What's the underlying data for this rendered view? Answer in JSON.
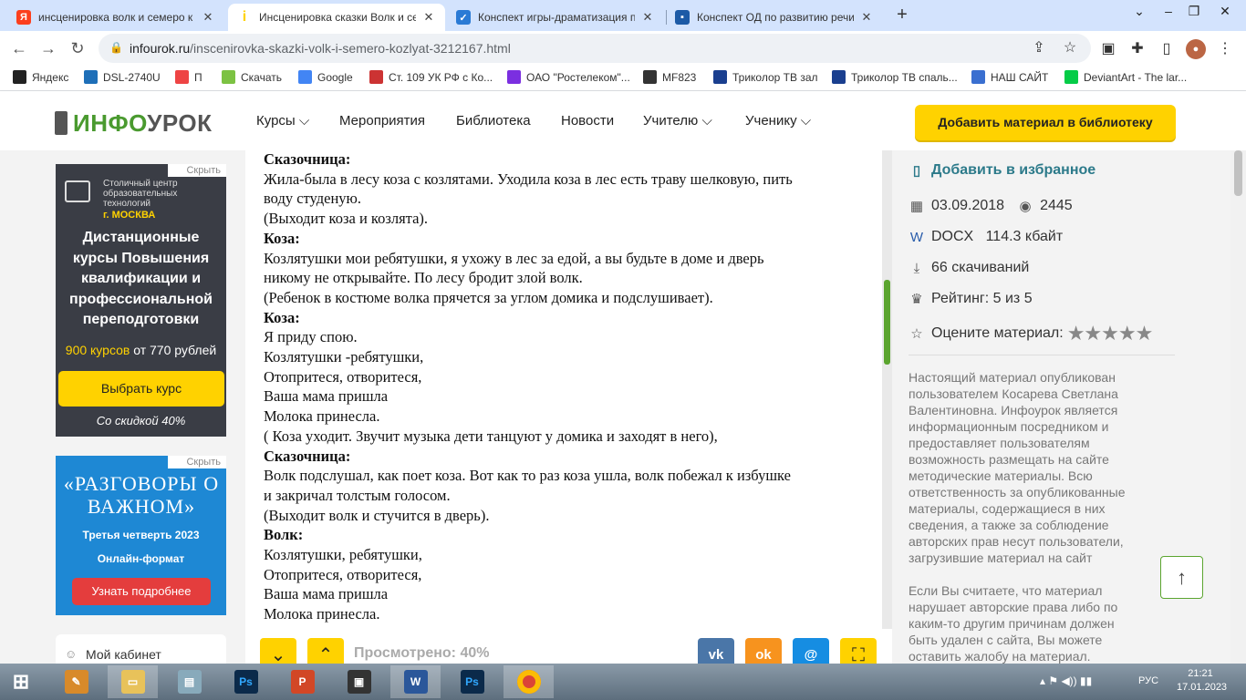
{
  "browser": {
    "tabs": [
      {
        "title": "инсценировка волк и семеро к",
        "favicon": "Я",
        "color": "#fc3f1d",
        "active": false
      },
      {
        "title": "Инсценировка сказки Волк и се",
        "favicon": "i",
        "color": "#ffd200",
        "active": true
      },
      {
        "title": "Конспект игры-драматизация п",
        "favicon": "✓",
        "color": "#2a7ad5",
        "active": false
      },
      {
        "title": "Конспект ОД по развитию речи",
        "favicon": "▪",
        "color": "#1c5aa6",
        "active": false
      }
    ],
    "new_tab": "+",
    "url_domain": "infourok.ru",
    "url_path": "/inscenirovka-skazki-volk-i-semero-kozlyat-3212167.html"
  },
  "bookmarks": [
    {
      "label": "Яндекс",
      "color": "#222"
    },
    {
      "label": "DSL-2740U",
      "color": "#1e6fb8"
    },
    {
      "label": "П",
      "color": "#e44"
    },
    {
      "label": "Скачать",
      "color": "#7cc243"
    },
    {
      "label": "Google",
      "color": "#4285f4"
    },
    {
      "label": "Ст. 109 УК РФ с Ко...",
      "color": "#c33"
    },
    {
      "label": "ОАО \"Ростелеком\"...",
      "color": "#7b2fe0"
    },
    {
      "label": "MF823",
      "color": "#333"
    },
    {
      "label": "Триколор ТВ зал",
      "color": "#1a3f8f"
    },
    {
      "label": "Триколор ТВ спаль...",
      "color": "#1a3f8f"
    },
    {
      "label": "НАШ САЙТ",
      "color": "#3a6fd0"
    },
    {
      "label": "DeviantArt - The lar...",
      "color": "#05cc47"
    }
  ],
  "site": {
    "logo_green": "ИНФО",
    "logo_gray": "УРОК",
    "nav": [
      "Курсы",
      "Мероприятия",
      "Библиотека",
      "Новости",
      "Учителю",
      "Ученику"
    ],
    "add_button": "Добавить материал в библиотеку"
  },
  "ad1": {
    "hide": "Скрыть",
    "org": "Столичный центр образовательных технологий",
    "city": "г. МОСКВА",
    "headline": "Дистанционные курсы Повышения квалификации и профессиональной переподготовки",
    "count": "900 курсов",
    "price": "от 770 рублей",
    "button": "Выбрать курс",
    "discount": "Со скидкой 40%"
  },
  "ad2": {
    "hide": "Скрыть",
    "title": "«РАЗГОВОРЫ О ВАЖНОМ»",
    "quarter": "Третья четверть 2023",
    "format": "Онлайн-формат",
    "button": "Узнать подробнее"
  },
  "cabinet": "Мой кабинет",
  "document": {
    "lines": [
      {
        "t": "Сказочница:",
        "b": true
      },
      {
        "t": "Жила-была в лесу коза с козлятами. Уходила коза в лес есть траву шелковую, пить",
        "b": false
      },
      {
        "t": "воду студеную.",
        "b": false
      },
      {
        "t": "(Выходит коза и козлята).",
        "b": false
      },
      {
        "t": "Коза:",
        "b": true
      },
      {
        "t": "Козлятушки мои ребятушки, я ухожу в лес за едой, а вы будьте в доме и дверь",
        "b": false
      },
      {
        "t": "никому не открывайте. По лесу бродит злой волк.",
        "b": false
      },
      {
        "t": "(Ребенок в костюме волка прячется за углом домика и подслушивает).",
        "b": false
      },
      {
        "t": "Коза:",
        "b": true
      },
      {
        "t": "Я приду спою.",
        "b": false
      },
      {
        "t": "Козлятушки -ребятушки,",
        "b": false
      },
      {
        "t": "Отопритеся, отворитеся,",
        "b": false
      },
      {
        "t": "Ваша мама пришла",
        "b": false
      },
      {
        "t": "Молока принесла.",
        "b": false
      },
      {
        "t": "( Коза уходит. Звучит музыка дети танцуют у домика и заходят в него),",
        "b": false
      },
      {
        "t": "Сказочница:",
        "b": true
      },
      {
        "t": "Волк подслушал, как поет коза. Вот как то раз коза ушла, волк побежал к избушке",
        "b": false
      },
      {
        "t": "и закричал толстым голосом.",
        "b": false
      },
      {
        "t": "(Выходит волк и стучится в дверь).",
        "b": false
      },
      {
        "t": "Волк:",
        "b": true
      },
      {
        "t": "Козлятушки, ребятушки,",
        "b": false
      },
      {
        "t": "Отопритеся, отворитеся,",
        "b": false
      },
      {
        "t": "Ваша мама пришла",
        "b": false
      },
      {
        "t": "Молока принесла.",
        "b": false
      }
    ],
    "viewed": "Просмотрено: 40%"
  },
  "sidebar": {
    "favorite": "Добавить в избранное",
    "date": "03.09.2018",
    "views": "2445",
    "format": "DOCX",
    "size": "114.3 кбайт",
    "downloads": "66 скачиваний",
    "rating": "Рейтинг: 5 из 5",
    "rate": "Оцените материал:",
    "stars": 5,
    "notice1": "Настоящий материал опубликован пользователем Косарева Светлана Валентиновна. Инфоурок является информационным посредником и предоставляет пользователям возможность размещать на сайте методические материалы. Всю ответственность за опубликованные материалы, содержащиеся в них сведения, а также за соблюдение авторских прав несут пользователи, загрузившие материал на сайт",
    "notice2": "Если Вы считаете, что материал нарушает авторские права либо по каким-то другим причинам должен быть удален с сайта, Вы можете оставить жалобу на материал."
  },
  "taskbar": {
    "lang": "РУС",
    "time": "21:21",
    "date": "17.01.2023"
  }
}
